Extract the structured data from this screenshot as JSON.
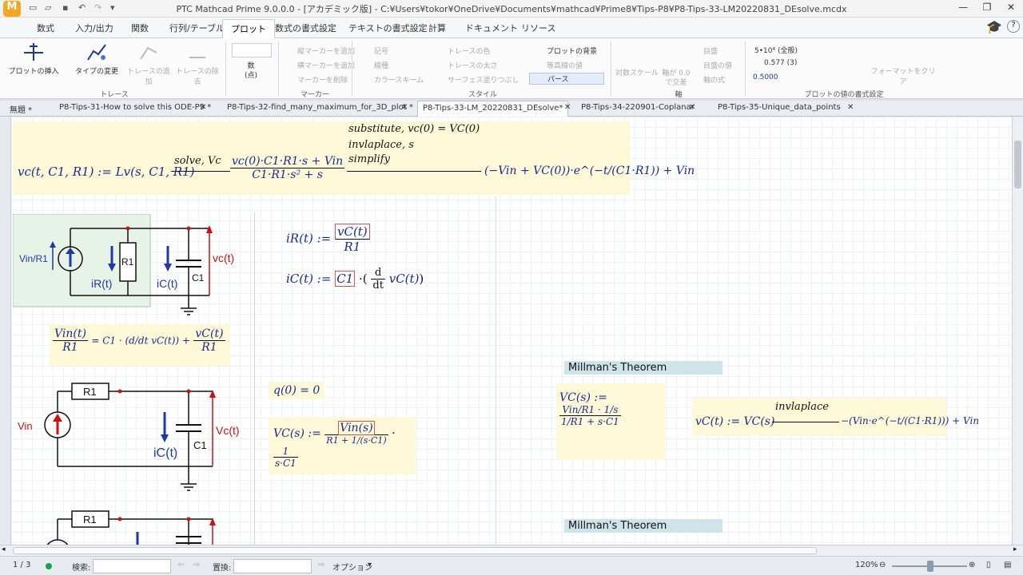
{
  "title": "PTC Mathcad Prime 9.0.0.0 - [アカデミック版] - C:¥Users¥tokor¥OneDrive¥Documents¥mathcad¥Prime8¥Tips-P8¥P8-Tips-33-LM20220831_DEsolve.mcdx",
  "window": {
    "minimize": "—",
    "restore": "❐",
    "close": "✕"
  },
  "ribbon_tabs": [
    "数式",
    "入力/出力",
    "関数",
    "行列/テーブル",
    "プロット",
    "数式の書式設定",
    "テキストの書式設定",
    "計算",
    "ドキュメント",
    "リソース"
  ],
  "ribbon": {
    "insert_plot": "プロットの挿入",
    "change_type": "タイプの変更",
    "add_trace": "トレースの追加",
    "remove_trace": "トレースの除去",
    "number_label": "数",
    "number_sub": "(点)",
    "vert_marker": "縦マーカーを追加",
    "horiz_marker": "横マーカーを追加",
    "delete_marker": "マーカーを削除",
    "symbol": "記号",
    "line": "線種",
    "color_scheme": "カラースキーム",
    "trace_color": "トレースの色",
    "trace_width": "トレースの太さ",
    "surface_fill": "サーフェス塗りつぶし",
    "plot_background": "プロットの背景",
    "contour_values": "等高線の値",
    "perspective": "パース",
    "log_scale": "対数スケール",
    "axis_cross": "軸が 0.0",
    "axis_cross2": "で交差",
    "grid": "目盛",
    "grid_values": "目盛の値",
    "axis_eq": "軸の式",
    "fmt1": "5•10⁴ (全般)",
    "fmt2": "0.577 (3)",
    "fmt3": "0.5000",
    "clear_format": "フォーマットをクリア",
    "groups": {
      "trace": "トレース",
      "marker": "マーカー",
      "style": "スタイル",
      "axis": "軸",
      "format": "プロットの値の書式設定"
    }
  },
  "doc_tabs": [
    "無題 *",
    "P8-Tips-31-How to solve this ODE-P9 *",
    "P8-Tips-32-find_many_maximum_for_3D_plot *",
    "P8-Tips-33-LM_20220831_DEsolve*",
    "P8-Tips-34-220901-Coplanar",
    "P8-Tips-35-Unique_data_points"
  ],
  "tab_close": "✕",
  "math": {
    "eq1_lhs": "vc(t, C1, R1) := Lv(s, C1, R1)",
    "eq1_kw1": "solve, Vc",
    "eq1_kw2": "substitute, vc(0) = VC(0)",
    "eq1_kw3": "invlaplace, s",
    "eq1_kw4": "simplify",
    "eq1_frac_n": "vc(0)·C1·R1·s + Vin",
    "eq1_frac_d": "C1·R1·s² + s",
    "eq1_result": "(−Vin + VC(0))·e^(−t/(C1·R1)) + Vin",
    "iR_lhs": "iR(t) :=",
    "iR_n": "vC(t)",
    "iR_d": "R1",
    "iC_lhs": "iC(t) :=",
    "iC_c": "C1",
    "iC_dn": "d",
    "iC_dd": "dt",
    "iC_v": "vC(t)",
    "kcl_n": "Vin(t)",
    "kcl_d": "R1",
    "kcl_mid": "= C1 · (d/dt vC(t)) +",
    "kcl_n2": "vC(t)",
    "kcl_d2": "R1",
    "q0": "q(0) = 0",
    "vcs_lhs": "VC(s) :=",
    "vcs_n": "Vin(s)",
    "vcs_d": "R1 + 1/(s·C1)",
    "vcs_mult": "·",
    "vcs_n2": "1",
    "vcs_d2": "s·C1",
    "millman1": "Millman's Theorem",
    "millman2": "Millman's Theorem",
    "mill_lhs": "VC(s) :=",
    "mill_n": "Vin/R1 · 1/s",
    "mill_d": "1/R1 + s·C1",
    "vct_lhs": "vC(t) := VC(s)",
    "vct_kw": "invlaplace",
    "vct_rhs": "−(Vin·e^(−t/(C1·R1))) + Vin"
  },
  "circuit1": {
    "src": "Vin/R1",
    "res": "R1",
    "cap": "C1",
    "iR": "iR(t)",
    "iC": "iC(t)",
    "vc": "vc(t)"
  },
  "circuit2": {
    "src": "Vin",
    "res": "R1",
    "cap": "C1",
    "iC": "iC(t)",
    "vc": "Vc(t)"
  },
  "circuit3": {
    "res": "R1"
  },
  "status": {
    "page": "1 / 3",
    "search_label": "検索:",
    "replace_label": "置換:",
    "options": "オプション",
    "zoom": "120%"
  },
  "colors": {
    "region": "#fdf9d8",
    "selection": "#d9534f",
    "header": "#cfe3ea",
    "wire": "#111111",
    "node": "#cc1111"
  }
}
